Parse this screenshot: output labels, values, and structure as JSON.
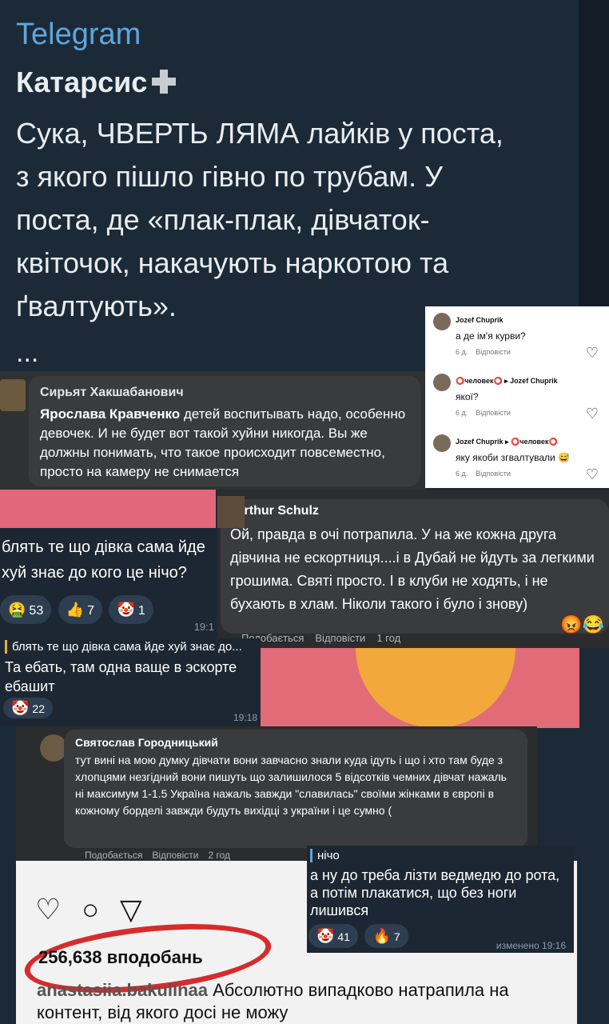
{
  "header": {
    "app_title": "Telegram",
    "channel_name": "Катарсис",
    "post_text": "Сука, ЧВЕРТЬ ЛЯМА лайків у поста, з якого пішло гівно по трубам. У поста, де «плак-плак, дівчаток-квіточок, накачують наркотою та ґвалтують».",
    "ellipsis": "..."
  },
  "fb_comment_1": {
    "author": "Сирьят Хакшабанович",
    "mention": "Ярослава Кравченко",
    "text": " детей воспитывать надо, особенно девочек. И не будет вот такой хуйни никогда. Вы же должны понимать, что такое происходит повсеместно, просто на камеру не снимается"
  },
  "instagram_replies": [
    {
      "user": "Jozef Chuprik",
      "text": "а де ім'я курви?",
      "time": "6 д.",
      "reply": "Відповісти"
    },
    {
      "user": "⭕человек⭕ ▸ Jozef Chuprik",
      "text": "якої?",
      "time": "6 д.",
      "reply": "Відповісти"
    },
    {
      "user": "Jozef Chuprik ▸ ⭕человек⭕",
      "text": "яку якоби згвалтували 😅",
      "time": "6 д.",
      "reply": "Відповісти"
    }
  ],
  "tg_message_1": {
    "text": "блять те що дівка сама йде хуй знає до кого це нічо?",
    "reactions": [
      {
        "emoji": "🤮",
        "count": "53"
      },
      {
        "emoji": "👍",
        "count": "7"
      },
      {
        "emoji": "🤡",
        "count": "1"
      }
    ],
    "time": "19:1"
  },
  "fb_comment_2": {
    "author": "Arthur Schulz",
    "text": "Ой, правда в очі потрапила. У на же кожна друга дівчина не ескортниця....і в Дубай не йдуть за легкими грошима. Святі просто. І в клуби не ходять, і не бухають в хлам. Ніколи такого і було і знову)",
    "like": "Подобається",
    "reply": "Відповісти",
    "time": "1 год",
    "emoji": "😡😂"
  },
  "tg_message_2": {
    "quote": "блять те що дівка сама йде хуй знає до...",
    "text": "Та ебать, там одна ваще в эскорте ебашит",
    "reactions": [
      {
        "emoji": "🤡",
        "count": "22"
      }
    ],
    "time": "19:18"
  },
  "fb_comment_3": {
    "author": "Святослав Городницький",
    "text": "тут вині на мою думку дівчати вони завчасно знали куда ідуть і що і хто там буде з хлопцями незгідний вони пишуть що залишилося 5 відсотків чемних дівчат нажаль ні максимум 1-1.5 Україна нажаль завжди \"славилась\" своїми жінками в європі в кожному борделі завжди будуть вихідці з україни і це сумно (",
    "like": "Подобається",
    "reply": "Відповісти",
    "time": "2 год"
  },
  "instagram_post": {
    "likes": "256,638 вподобань",
    "caption_user": "anastasiia.bakulinaa",
    "caption": " Абсолютно випадково натрапила на контент, від якого досі не можу"
  },
  "tg_message_3": {
    "quote": "нічо",
    "text": "а ну до треба лізти ведмедю до рота, а потім плакатися, що без ноги лишився",
    "reactions": [
      {
        "emoji": "🤡",
        "count": "41"
      },
      {
        "emoji": "🔥",
        "count": "7"
      }
    ],
    "time": "изменено 19:16"
  }
}
